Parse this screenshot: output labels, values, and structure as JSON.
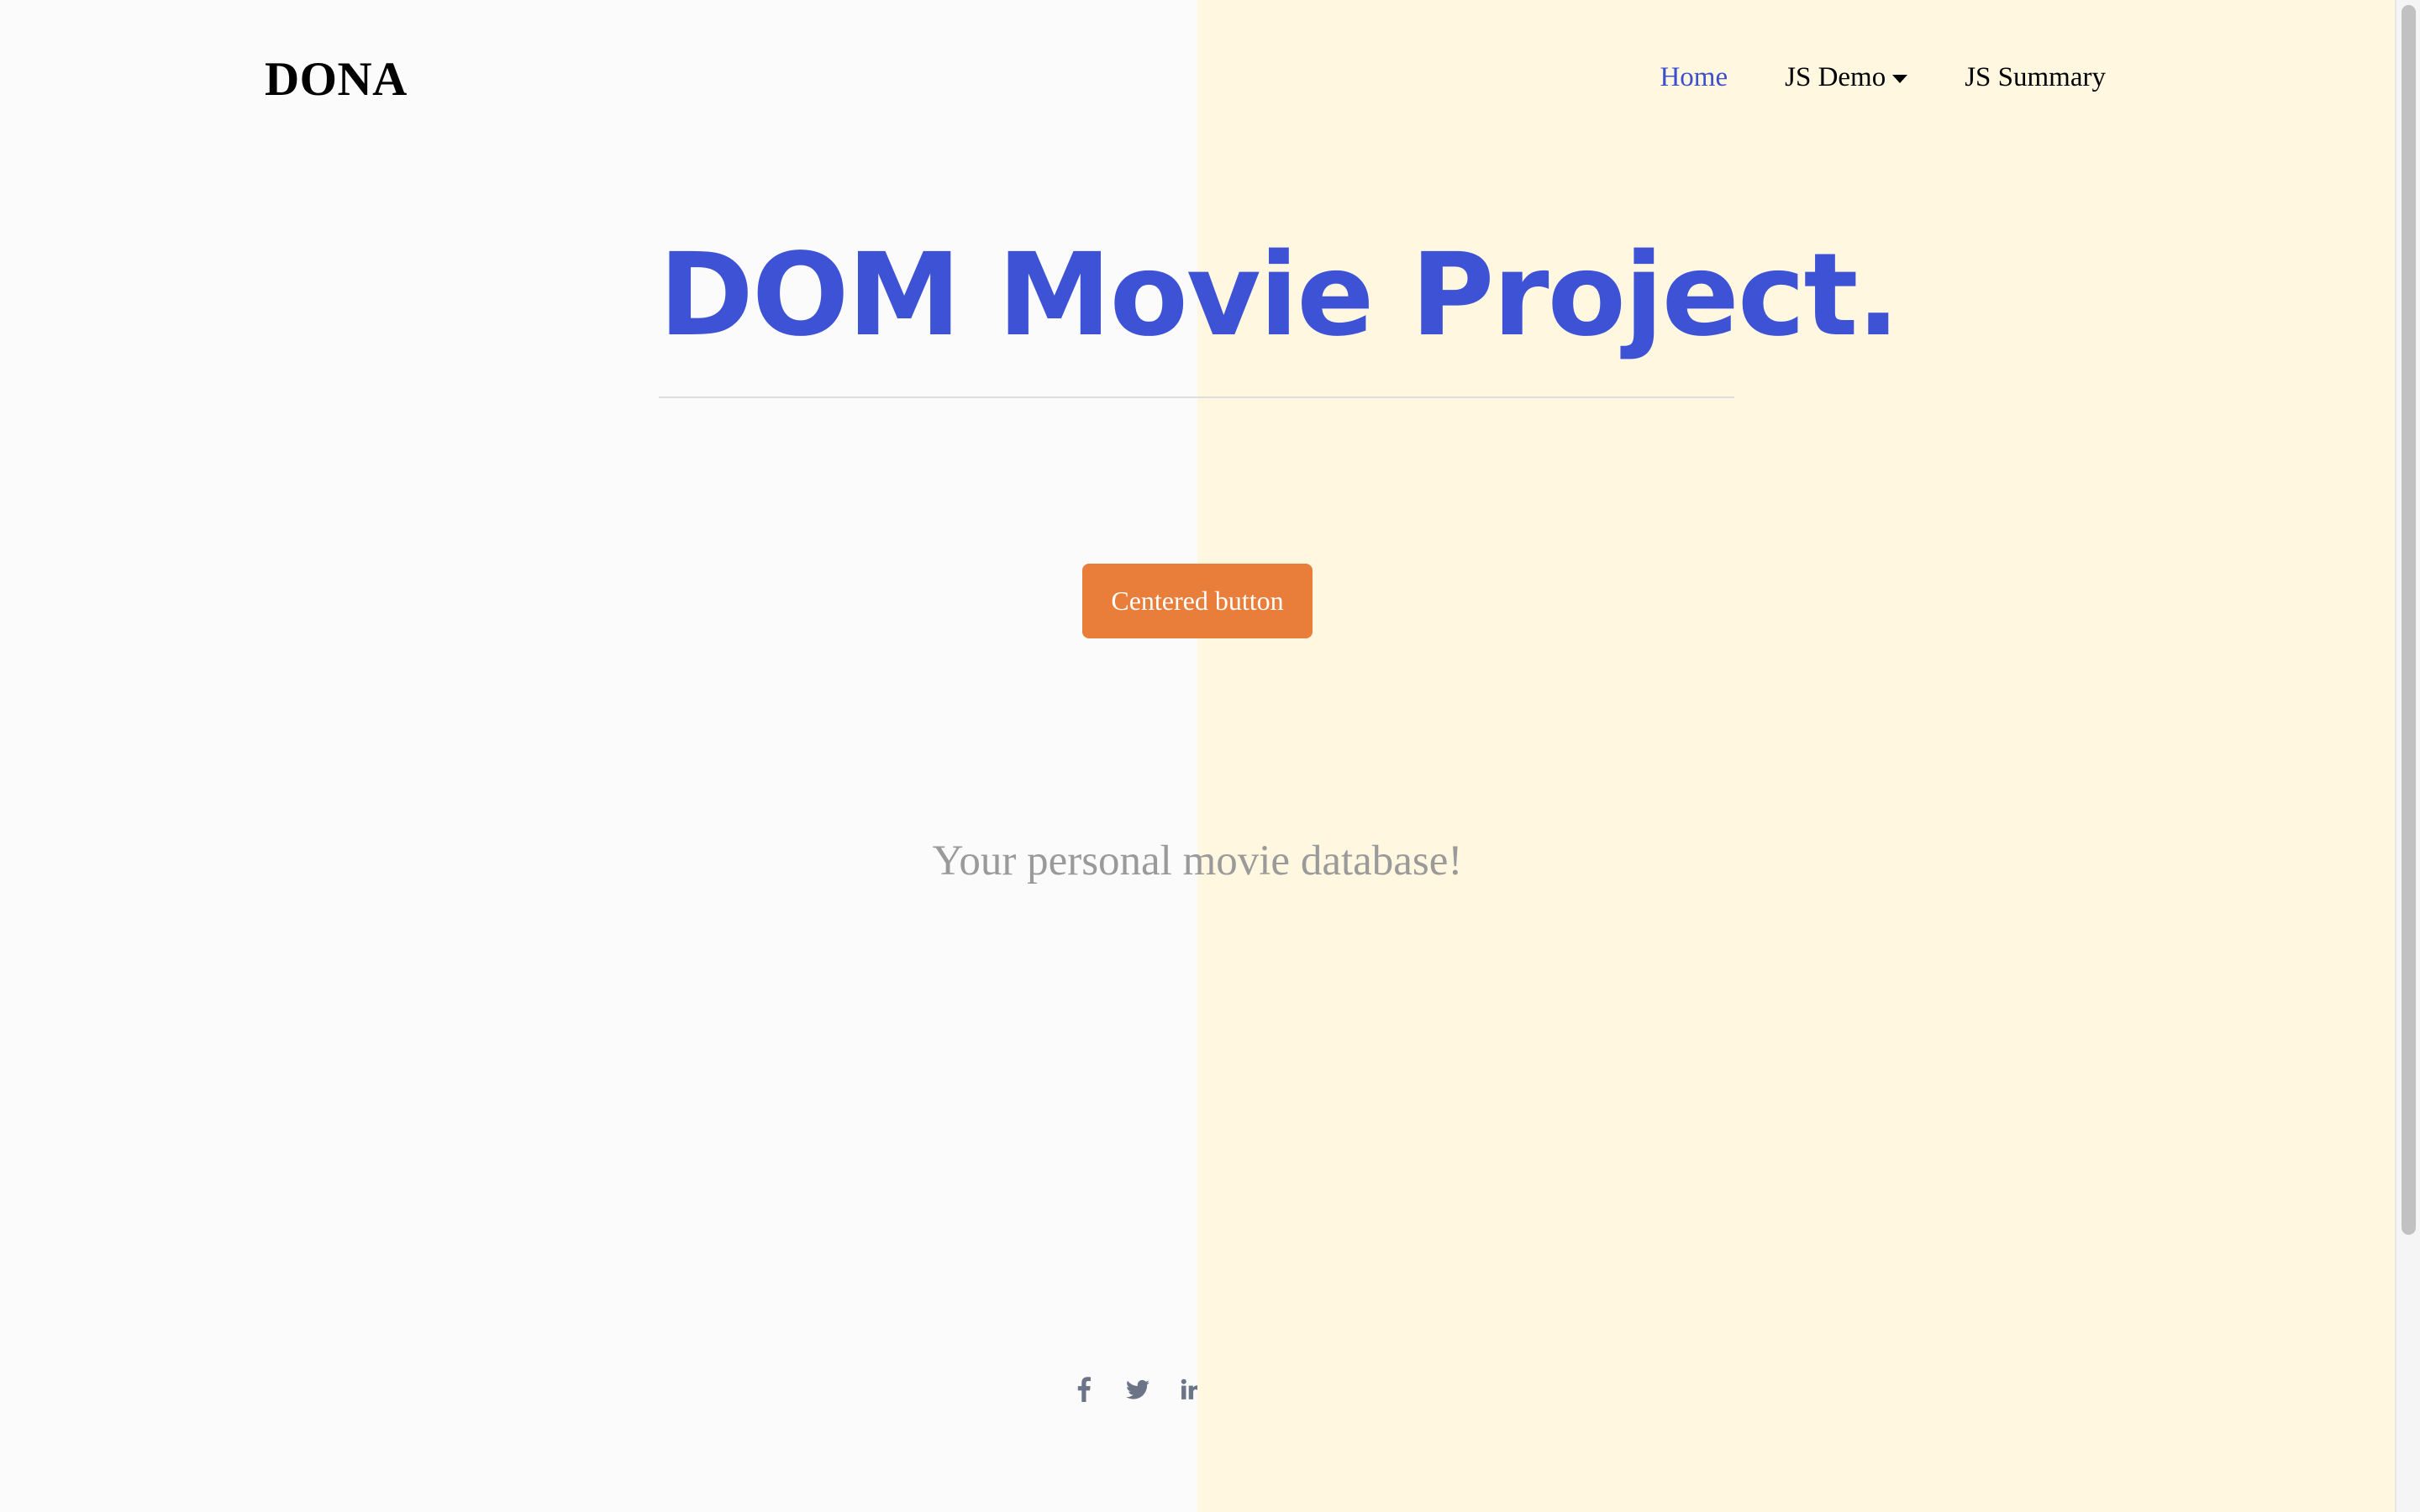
{
  "nav": {
    "brand": "DONA",
    "links": [
      {
        "label": "Home",
        "active": true
      },
      {
        "label": "JS Demo",
        "dropdown": true
      },
      {
        "label": "JS Summary"
      }
    ]
  },
  "hero": {
    "title": "DOM Movie Project.",
    "button_label": "Centered button",
    "tagline": "Your personal movie database!"
  },
  "footer": {
    "social_icons": [
      "facebook-icon",
      "twitter-icon",
      "linkedin-icon"
    ]
  },
  "colors": {
    "accent": "#3d52d5",
    "button": "#e97e3a",
    "background_left": "#fbfbfc",
    "background_right": "#fff7e0",
    "tagline": "#9a9a9a",
    "social": "#6b7587"
  }
}
